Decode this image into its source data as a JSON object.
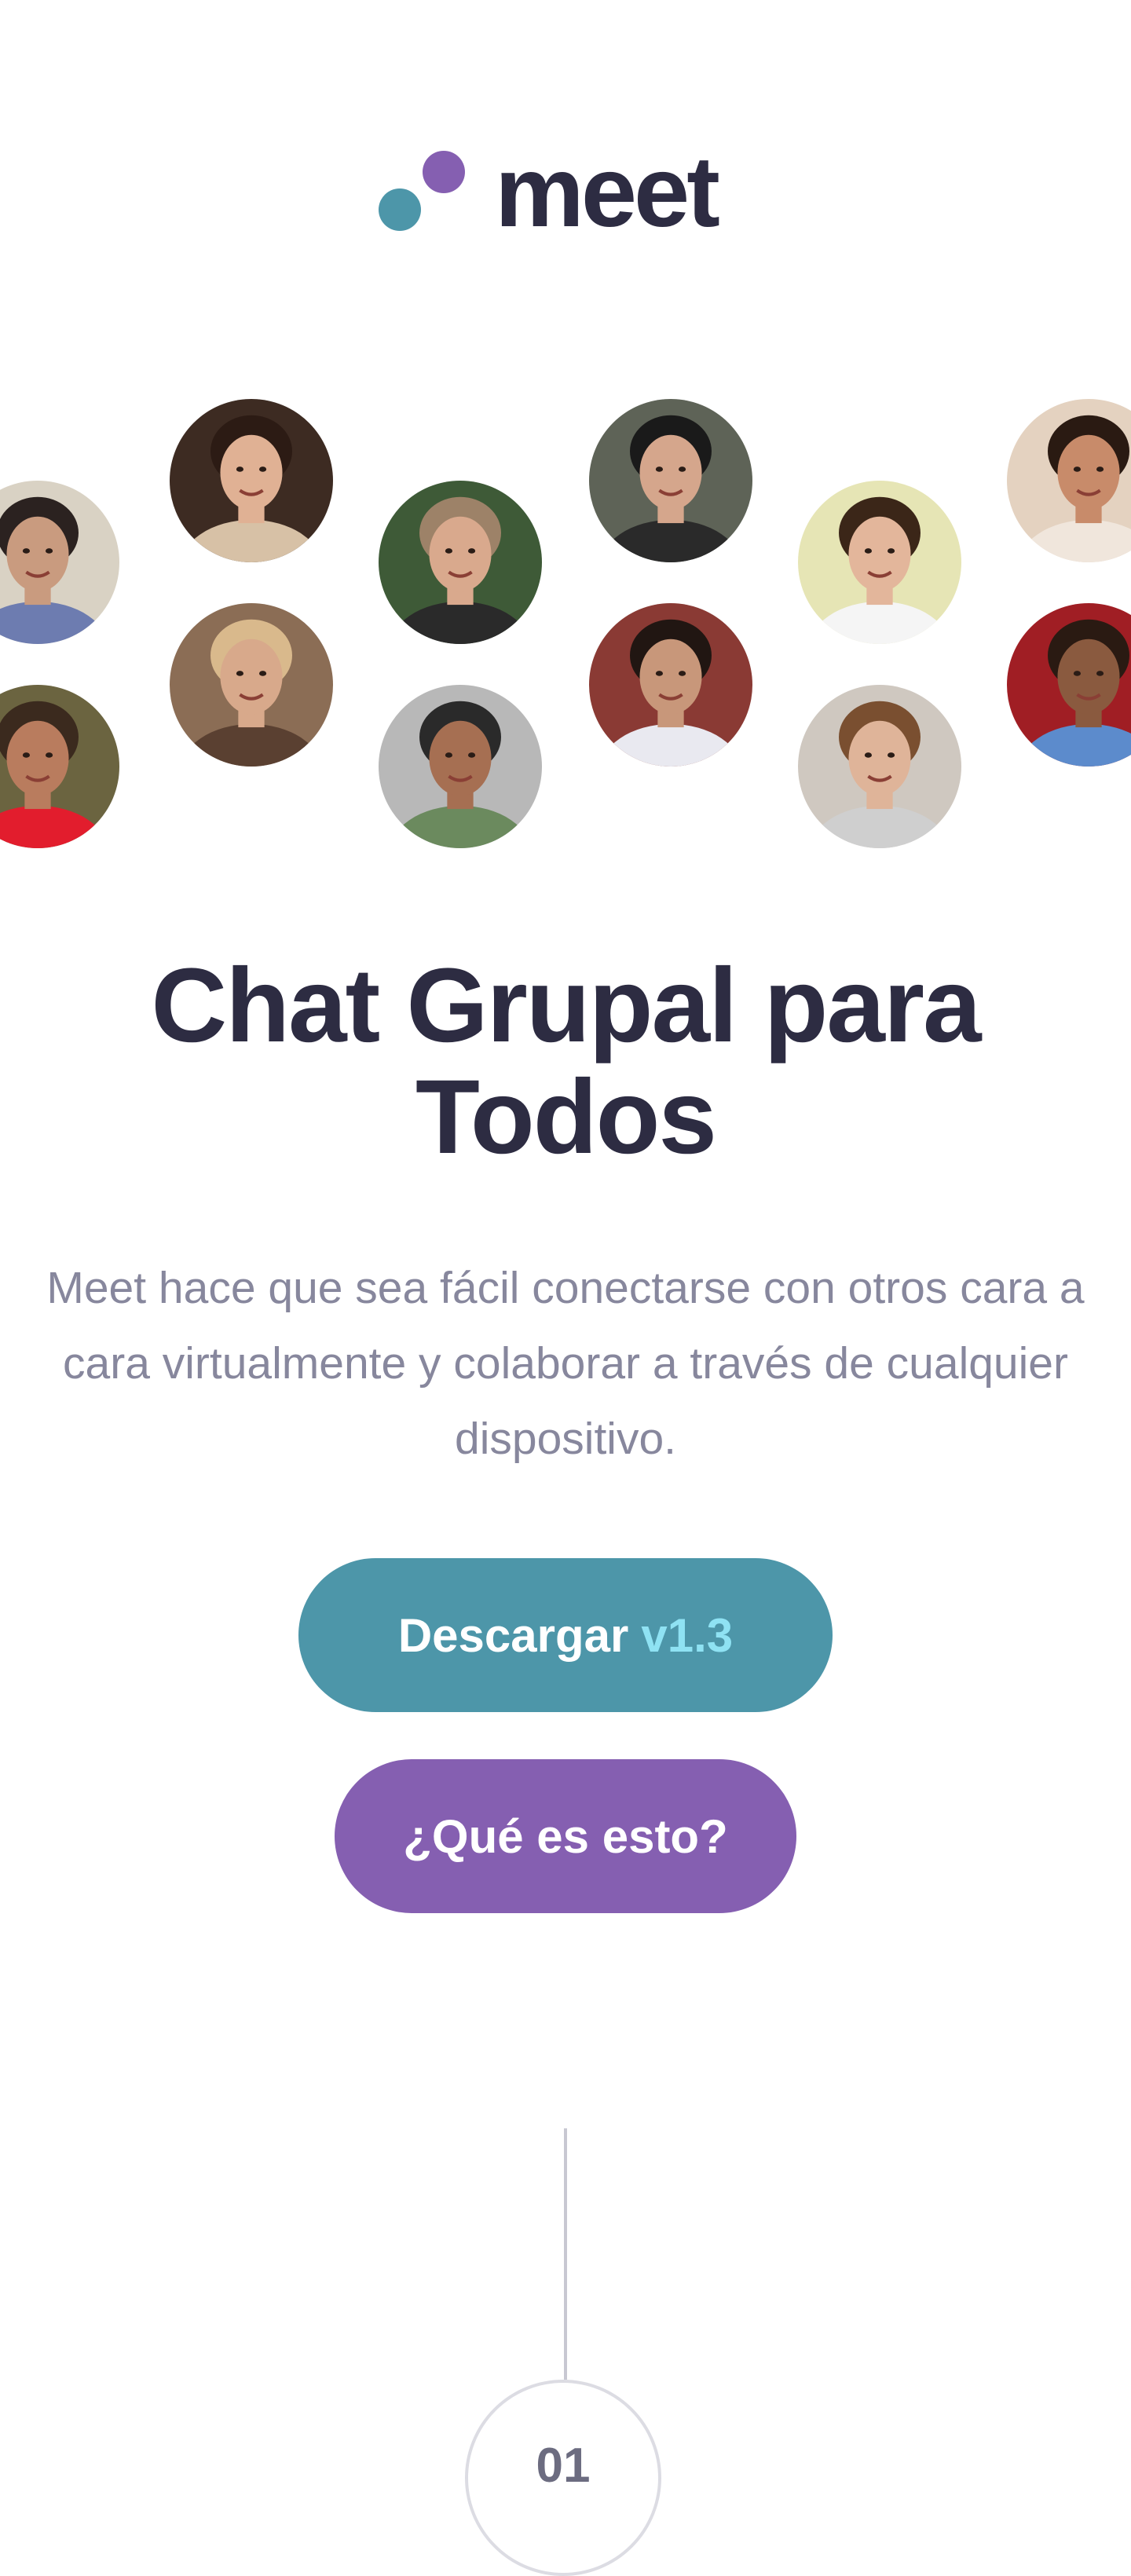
{
  "colors": {
    "dark": "#2d2c42",
    "teal": "#4d96a9",
    "purple": "#855fb1",
    "muted": "#87879d",
    "light_blue": "#8fe2f3",
    "line": "#c8c8d2"
  },
  "logo": {
    "wordmark": "meet",
    "icon": "two-dots-logo-icon"
  },
  "avatars": [
    {
      "name": "avatar-young-man-curly-hair",
      "bg": "#d9d2c4",
      "skin": "#c99b7f",
      "hair": "#2b2220",
      "shirt": "#6d7cb0"
    },
    {
      "name": "avatar-bearded-man-hat",
      "bg": "#6b6440",
      "skin": "#b97c5e",
      "hair": "#3b2a1e",
      "shirt": "#e21d2d"
    },
    {
      "name": "avatar-smiling-woman-dark-hair",
      "bg": "#3d2b22",
      "skin": "#e0b194",
      "hair": "#2c1b14",
      "shirt": "#d7c1a6"
    },
    {
      "name": "avatar-laughing-blonde-woman",
      "bg": "#8b6d55",
      "skin": "#d8a98b",
      "hair": "#d9b98c",
      "shirt": "#5a4031"
    },
    {
      "name": "avatar-man-fur-collar",
      "bg": "#3e5a37",
      "skin": "#d9a98d",
      "hair": "#9d8268",
      "shirt": "#2a2a2a"
    },
    {
      "name": "avatar-older-man-smiling",
      "bg": "#b8b8b8",
      "skin": "#a66f52",
      "hair": "#2a2a2a",
      "shirt": "#6b8a5e"
    },
    {
      "name": "avatar-man-sunglasses",
      "bg": "#5e6357",
      "skin": "#d5a68c",
      "hair": "#1a1a1a",
      "shirt": "#2a2a2a"
    },
    {
      "name": "avatar-man-flowers-background",
      "bg": "#8a3a34",
      "skin": "#c8977a",
      "hair": "#211612",
      "shirt": "#e9e9f0"
    },
    {
      "name": "avatar-smiling-man-yellow-background",
      "bg": "#e6e5b5",
      "skin": "#e3b69b",
      "hair": "#3b2618",
      "shirt": "#f5f5f5"
    },
    {
      "name": "avatar-man-wavy-hair",
      "bg": "#cfc8c0",
      "skin": "#dfb499",
      "hair": "#7a4f30",
      "shirt": "#cfcfcf"
    },
    {
      "name": "avatar-couple-flowers",
      "bg": "#e4d2c0",
      "skin": "#c88b6a",
      "hair": "#2a1a12",
      "shirt": "#f0e6dc"
    },
    {
      "name": "avatar-woman-red-background",
      "bg": "#a01e24",
      "skin": "#8a5a3f",
      "hair": "#2a1a12",
      "shirt": "#5c8bcc"
    }
  ],
  "hero": {
    "title": "Chat Grupal para Todos",
    "subtitle": "Meet hace que sea fácil conectarse con otros cara a cara virtualmente y colaborar a través de cualquier dispositivo."
  },
  "buttons": {
    "download_label": "Descargar",
    "download_version": "v1.3",
    "what_label": "¿Qué es esto?"
  },
  "step": {
    "number": "01"
  }
}
